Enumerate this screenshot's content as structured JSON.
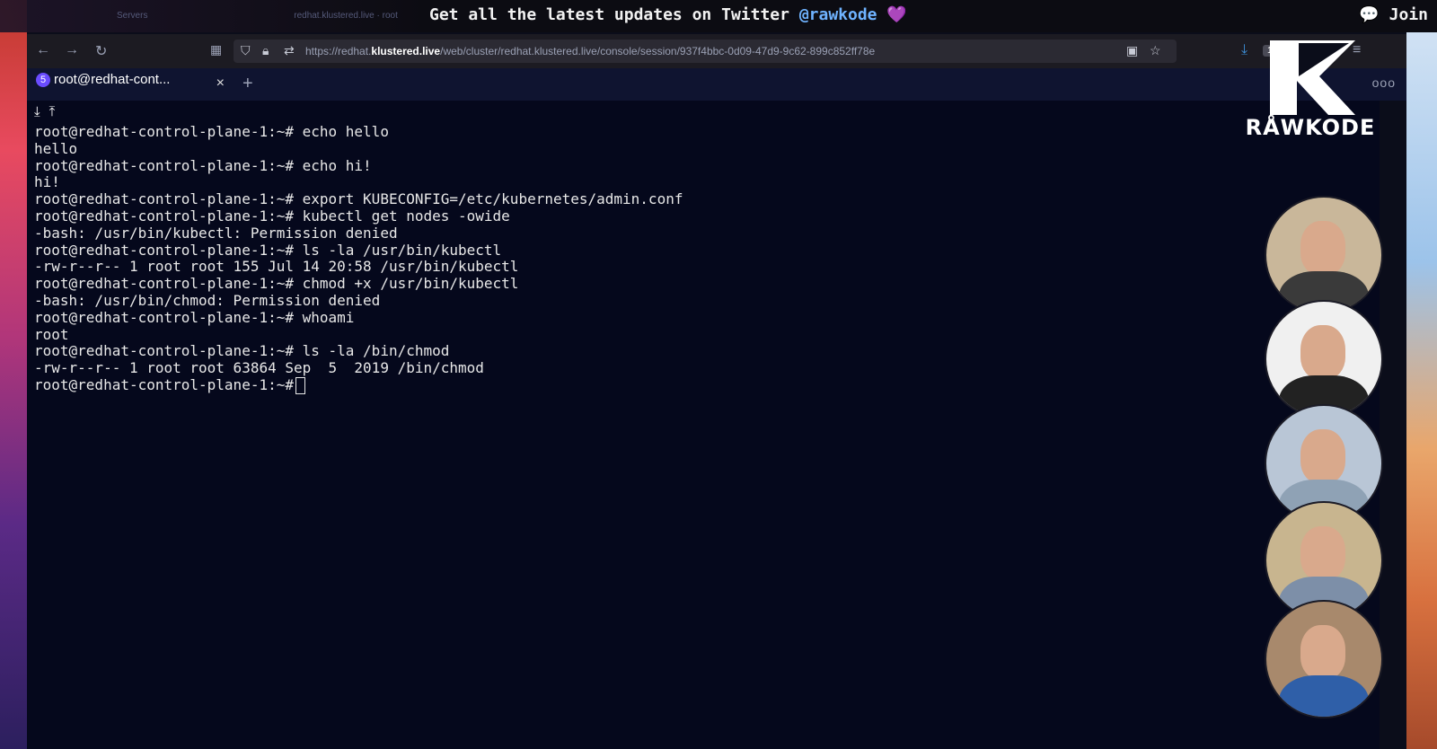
{
  "banner": {
    "message_prefix": "Get all the latest updates on Twitter ",
    "handle": "@rawkode",
    "heart": "💜",
    "join_label": "Join",
    "ghost_tab_1": "Servers",
    "ghost_tab_2": "redhat.klustered.live · root"
  },
  "browser": {
    "back_icon": "←",
    "forward_icon": "→",
    "reload_icon": "↻",
    "url_prefix": "https://redhat.",
    "url_domain": "klustered.live",
    "url_rest": "/web/cluster/redhat.klustered.live/console/session/937f4bbc-0d09-47d9-9c62-899c852ff78e",
    "zoom": "133%"
  },
  "tabbar": {
    "tab_number": "5",
    "tab_title": "root@redhat-cont...",
    "close_icon": "×",
    "new_tab_icon": "+",
    "more_icon": "ooo"
  },
  "terminal": {
    "download_icon": "⤓",
    "upload_icon": "⤒",
    "lines": [
      "root@redhat-control-plane-1:~# echo hello",
      "hello",
      "root@redhat-control-plane-1:~# echo hi!",
      "hi!",
      "root@redhat-control-plane-1:~# export KUBECONFIG=/etc/kubernetes/admin.conf",
      "root@redhat-control-plane-1:~# kubectl get nodes -owide",
      "-bash: /usr/bin/kubectl: Permission denied",
      "root@redhat-control-plane-1:~# ls -la /usr/bin/kubectl",
      "-rw-r--r-- 1 root root 155 Jul 14 20:58 /usr/bin/kubectl",
      "root@redhat-control-plane-1:~# chmod +x /usr/bin/kubectl",
      "-bash: /usr/bin/chmod: Permission denied",
      "root@redhat-control-plane-1:~# whoami",
      "root",
      "root@redhat-control-plane-1:~# ls -la /bin/chmod",
      "-rw-r--r-- 1 root root 63864 Sep  5  2019 /bin/chmod"
    ],
    "prompt": "root@redhat-control-plane-1:~# "
  },
  "logo": {
    "brand": "RÅWKODE"
  },
  "participants": [
    {
      "bg": "#c9b79a",
      "shirt": "#3a3a3a"
    },
    {
      "bg": "#f0f0f0",
      "shirt": "#222222"
    },
    {
      "bg": "#b9c6d6",
      "shirt": "#8fa2b5"
    },
    {
      "bg": "#c8b58f",
      "shirt": "#7d8fa8"
    },
    {
      "bg": "#a8896c",
      "shirt": "#2f5fa8"
    }
  ]
}
